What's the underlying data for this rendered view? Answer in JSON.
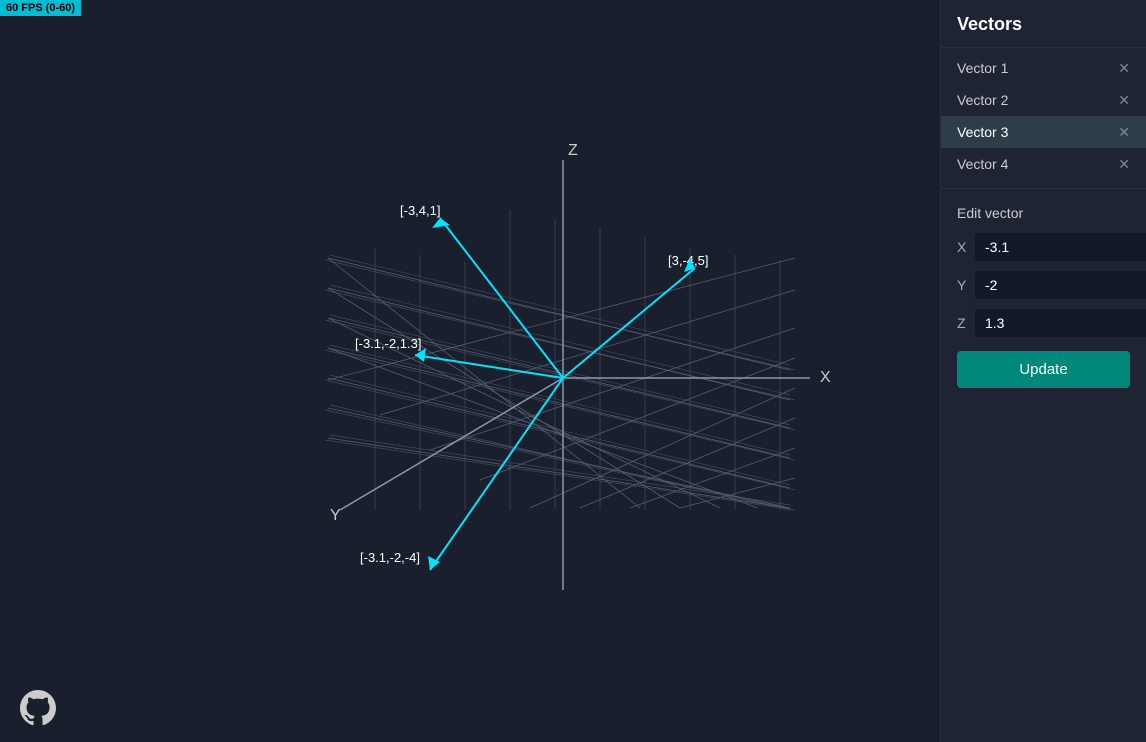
{
  "fps": {
    "label": "60 FPS (0-60)"
  },
  "panel": {
    "title": "Vectors",
    "vectors": [
      {
        "id": "v1",
        "label": "Vector 1",
        "active": false
      },
      {
        "id": "v2",
        "label": "Vector 2",
        "active": false
      },
      {
        "id": "v3",
        "label": "Vector 3",
        "active": true
      },
      {
        "id": "v4",
        "label": "Vector 4",
        "active": false
      }
    ],
    "edit": {
      "title": "Edit vector",
      "x_label": "X",
      "y_label": "Y",
      "z_label": "Z",
      "x_value": "-3.1",
      "y_value": "-2",
      "z_value": "1.3",
      "update_label": "Update"
    }
  },
  "graph": {
    "axis_x": "X",
    "axis_y": "Y",
    "axis_z": "Z",
    "vector_labels": [
      "[-3,4,1]",
      "[3,-4,5]",
      "[-3.1,-2,1.3]",
      "[-3.1,-2,-4]"
    ]
  }
}
